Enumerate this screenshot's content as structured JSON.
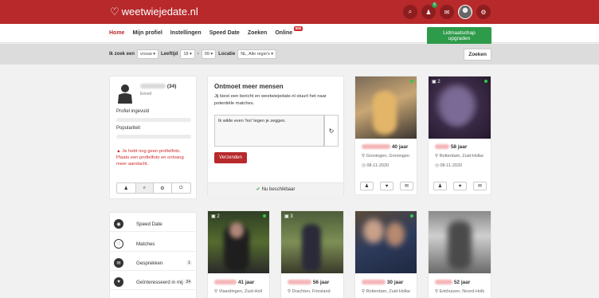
{
  "header": {
    "logo_text": "weetwiejedate.nl",
    "msg_count": "6"
  },
  "nav": {
    "items": [
      "Home",
      "Mijn profiel",
      "Instellingen",
      "Speed Date",
      "Zoeken",
      "Online"
    ],
    "online_badge": "555",
    "upgrade_label": "Lidmaatschap upgraden"
  },
  "search": {
    "ik_zoek": "Ik zoek een",
    "gender": "vrouw",
    "leeftijd": "Leeftijd",
    "age_from": "18",
    "dash": "-",
    "age_to": "99",
    "locatie": "Locatie",
    "region": "NL, Alle regio's",
    "button": "Zoeken"
  },
  "profile": {
    "age": "(34)",
    "sub": "Eenvd",
    "profile_label": "Profiel ingevuld",
    "pop_label": "Populariteit",
    "warning": "Je hebt nog geen profielfoto. Plaats een profielfoto en ontvang meer aandacht."
  },
  "meet": {
    "title": "Ontmoet meer mensen",
    "desc": "Jij kiest een bericht en weetwiejedate.nl stuurt het naar potentiële matches.",
    "message": "Ik wilde even 'hoi' tegen je zeggen.",
    "send": "Verzenden",
    "status": "Nu beschikbaar"
  },
  "matches_top": [
    {
      "age": "40 jaar",
      "place": "Groningen, Groningen",
      "date": "08-11-2020",
      "photos": ""
    },
    {
      "age": "58 jaar",
      "place": "Rotterdam, Zuid-Hollar",
      "date": "08-11-2020",
      "photos": "2"
    }
  ],
  "sidebar_menu": [
    {
      "label": "Speed Date",
      "count": ""
    },
    {
      "label": "Matches",
      "count": ""
    },
    {
      "label": "Gesprekken",
      "count": "1"
    },
    {
      "label": "Geïnteresseerd in mij",
      "count": "24"
    }
  ],
  "matches_bottom": [
    {
      "age": "41 jaar",
      "place": "Vlaardingen, Zuid-Holl",
      "photos": "2"
    },
    {
      "age": "56 jaar",
      "place": "Drachten, Friesland",
      "photos": "3"
    },
    {
      "age": "30 jaar",
      "place": "Rotterdam, Zuid-Hollar",
      "photos": ""
    },
    {
      "age": "52 jaar",
      "place": "Enkhuizen, Noord-Holk",
      "photos": ""
    }
  ]
}
